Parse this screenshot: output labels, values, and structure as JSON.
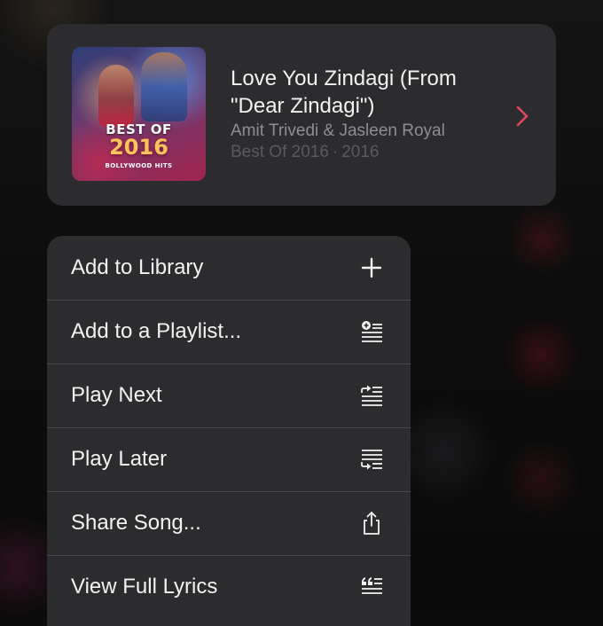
{
  "song_card": {
    "title": "Love You Zindagi (From \"Dear Zindagi\")",
    "artist": "Amit Trivedi & Jasleen Royal",
    "album": "Best Of 2016",
    "separator": "·",
    "year": "2016",
    "artwork_text_line1": "BEST OF",
    "artwork_text_line2": "2016",
    "artwork_text_line3": "BOLLYWOOD HITS",
    "chevron_color": "#e0475c"
  },
  "menu": {
    "items": [
      {
        "label": "Add to Library",
        "icon": "plus-icon"
      },
      {
        "label": "Add to a Playlist...",
        "icon": "add-to-playlist-icon"
      },
      {
        "label": "Play Next",
        "icon": "play-next-icon"
      },
      {
        "label": "Play Later",
        "icon": "play-later-icon"
      },
      {
        "label": "Share Song...",
        "icon": "share-icon"
      },
      {
        "label": "View Full Lyrics",
        "icon": "lyrics-icon"
      }
    ]
  },
  "colors": {
    "card_background": "#2c2c2e",
    "primary_text": "#f2f2f2",
    "secondary_text": "#8e8e93",
    "tertiary_text": "#5b5b5f",
    "accent": "#e0475c"
  }
}
